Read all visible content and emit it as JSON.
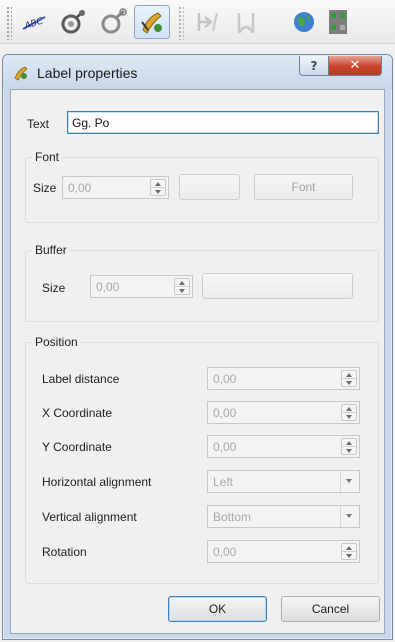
{
  "toolbar": {
    "icons": [
      {
        "name": "label-abc-icon",
        "state": "enabled"
      },
      {
        "name": "pin-labels-icon",
        "state": "enabled"
      },
      {
        "name": "show-hide-labels-icon",
        "state": "enabled"
      },
      {
        "name": "label-properties-icon",
        "state": "active"
      },
      {
        "name": "move-label-icon",
        "state": "disabled"
      },
      {
        "name": "rotate-label-icon",
        "state": "disabled"
      },
      {
        "name": "globe-icon",
        "state": "enabled"
      },
      {
        "name": "grid-tool-icon",
        "state": "enabled"
      }
    ]
  },
  "dialog": {
    "title": "Label properties",
    "help_label": "?",
    "close_label": "✕",
    "text_label": "Text",
    "text_value": "Gg. Po",
    "font": {
      "group_title": "Font",
      "size_label": "Size",
      "size_value": "0,00",
      "font_button": "Font"
    },
    "buffer": {
      "group_title": "Buffer",
      "size_label": "Size",
      "size_value": "0,00"
    },
    "position": {
      "group_title": "Position",
      "label_distance_label": "Label distance",
      "label_distance_value": "0,00",
      "x_label": "X Coordinate",
      "x_value": "0,00",
      "y_label": "Y Coordinate",
      "y_value": "0,00",
      "halign_label": "Horizontal alignment",
      "halign_value": "Left",
      "valign_label": "Vertical alignment",
      "valign_value": "Bottom",
      "rotation_label": "Rotation",
      "rotation_value": "0,00"
    },
    "ok_label": "OK",
    "cancel_label": "Cancel"
  },
  "colors": {
    "focus_border": "#3c7fb1",
    "close_button": "#c9452c",
    "disabled_text": "#a8a8a8"
  }
}
